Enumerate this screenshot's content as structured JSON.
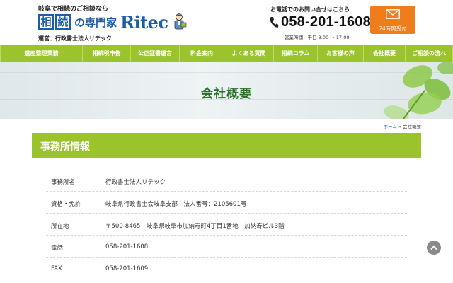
{
  "header": {
    "tagline": "岐阜で相続のご相談なら",
    "logo_kanji_1": "相",
    "logo_kanji_2": "続",
    "logo_suffix": "の専門家",
    "logo_brand": "Ritec",
    "operator": "運営：行政書士法人リテック",
    "phone_prompt": "お電話でのお問い合せはこちら",
    "phone_number": "058-201-1608",
    "hours": "営業時間：平日 9:00 〜 17:00",
    "mail_label": "24時間受付"
  },
  "nav": {
    "items": [
      {
        "label": "遺産整理業務"
      },
      {
        "label": "相続税申告"
      },
      {
        "label": "公正証書遺言"
      },
      {
        "label": "料金案内"
      },
      {
        "label": "よくある質問"
      },
      {
        "label": "相続コラム"
      },
      {
        "label": "お客様の声"
      },
      {
        "label": "会社概要"
      },
      {
        "label": "ご相談の流れ"
      }
    ]
  },
  "hero": {
    "title": "会社概要"
  },
  "breadcrumb": {
    "home": "ホーム",
    "separator": "»",
    "current": "会社概要"
  },
  "section": {
    "title": "事務所情報"
  },
  "info": {
    "rows": [
      {
        "label": "事務所名",
        "value": "行政書士法人リテック"
      },
      {
        "label": "資格・免許",
        "value": "岐阜県行政書士会岐阜支部　法人番号：2105601号"
      },
      {
        "label": "所在地",
        "value": "〒500-8465　岐阜県岐阜市加納寿町4丁目1番地　加納寿ビル3階"
      },
      {
        "label": "電話",
        "value": "058-201-1608"
      },
      {
        "label": "FAX",
        "value": "058-201-1609"
      }
    ]
  },
  "icons": {
    "phone": "phone-icon",
    "mail": "mail-icon",
    "scroll_top": "chevron-up-icon",
    "mascot": "mascot-illustration"
  },
  "colors": {
    "brand_blue": "#1d5fa6",
    "nav_green": "#9bc42c",
    "accent_orange": "#ef7d1c",
    "title_green": "#2c6e2c"
  }
}
